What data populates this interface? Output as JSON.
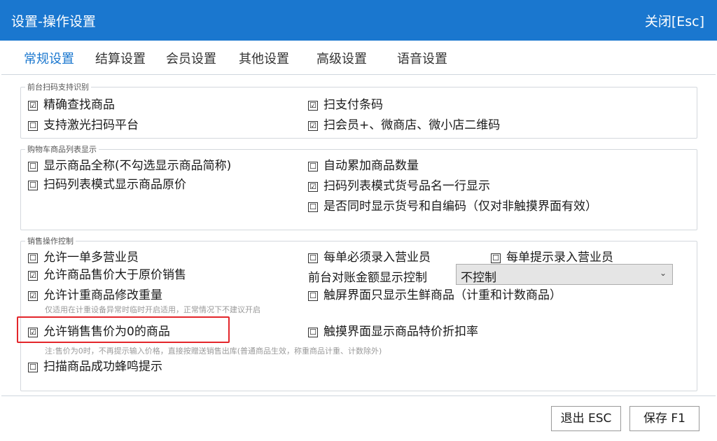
{
  "window": {
    "title": "设置-操作设置",
    "close_label": "关闭[Esc]"
  },
  "tabs": [
    {
      "label": "常规设置",
      "active": true
    },
    {
      "label": "结算设置",
      "active": false
    },
    {
      "label": "会员设置",
      "active": false
    },
    {
      "label": "其他设置",
      "active": false
    },
    {
      "label": "高级设置",
      "active": false
    },
    {
      "label": "语音设置",
      "active": false
    }
  ],
  "groups": {
    "scan": {
      "title": "前台扫码支持识别",
      "options": [
        {
          "label": "精确查找商品",
          "checked": true
        },
        {
          "label": "支持激光扫码平台",
          "checked": false
        },
        {
          "label": "扫支付条码",
          "checked": true
        },
        {
          "label": "扫会员+、微商店、微小店二维码",
          "checked": true
        }
      ]
    },
    "cart": {
      "title": "购物车商品列表显示",
      "options": [
        {
          "label": "显示商品全称(不勾选显示商品简称)",
          "checked": false
        },
        {
          "label": "扫码列表模式显示商品原价",
          "checked": false
        },
        {
          "label": "自动累加商品数量",
          "checked": false
        },
        {
          "label": "扫码列表模式货号品名一行显示",
          "checked": true
        },
        {
          "label": "是否同时显示货号和自编码（仅对非触摸界面有效）",
          "checked": false
        }
      ]
    },
    "sales": {
      "title": "销售操作控制",
      "options": [
        {
          "label": "允许一单多营业员",
          "checked": false
        },
        {
          "label": "允许商品售价大于原价销售",
          "checked": true
        },
        {
          "label": "允许计重商品修改重量",
          "checked": true
        },
        {
          "label": "允许销售售价为0的商品",
          "checked": true
        },
        {
          "label": "扫描商品成功蜂鸣提示",
          "checked": false
        },
        {
          "label": "每单必须录入营业员",
          "checked": false
        },
        {
          "label": "每单提示录入营业员",
          "checked": false
        },
        {
          "label": "触屏界面只显示生鲜商品（计重和计数商品）",
          "checked": false
        },
        {
          "label": "触摸界面显示商品特价折扣率",
          "checked": false
        }
      ],
      "reconcile_label": "前台对账金额显示控制",
      "reconcile_value": "不控制",
      "note_weight": "仅适用在计重设备异常时临时开启适用，正常情况下不建议开启",
      "note_zero_price": "注:售价为0时，不再提示输入价格，直接按赠送销售出库(普通商品生效，称重商品计重、计数除外)"
    }
  },
  "buttons": {
    "exit": "退出 ESC",
    "save": "保存 F1"
  },
  "icons": {
    "checked": "☑",
    "unchecked": "☐",
    "dropdown": "chevron-down-icon"
  },
  "colors": {
    "titlebar": "#1a77cf",
    "accent": "#1a77cf",
    "highlight": "#e3262b"
  }
}
